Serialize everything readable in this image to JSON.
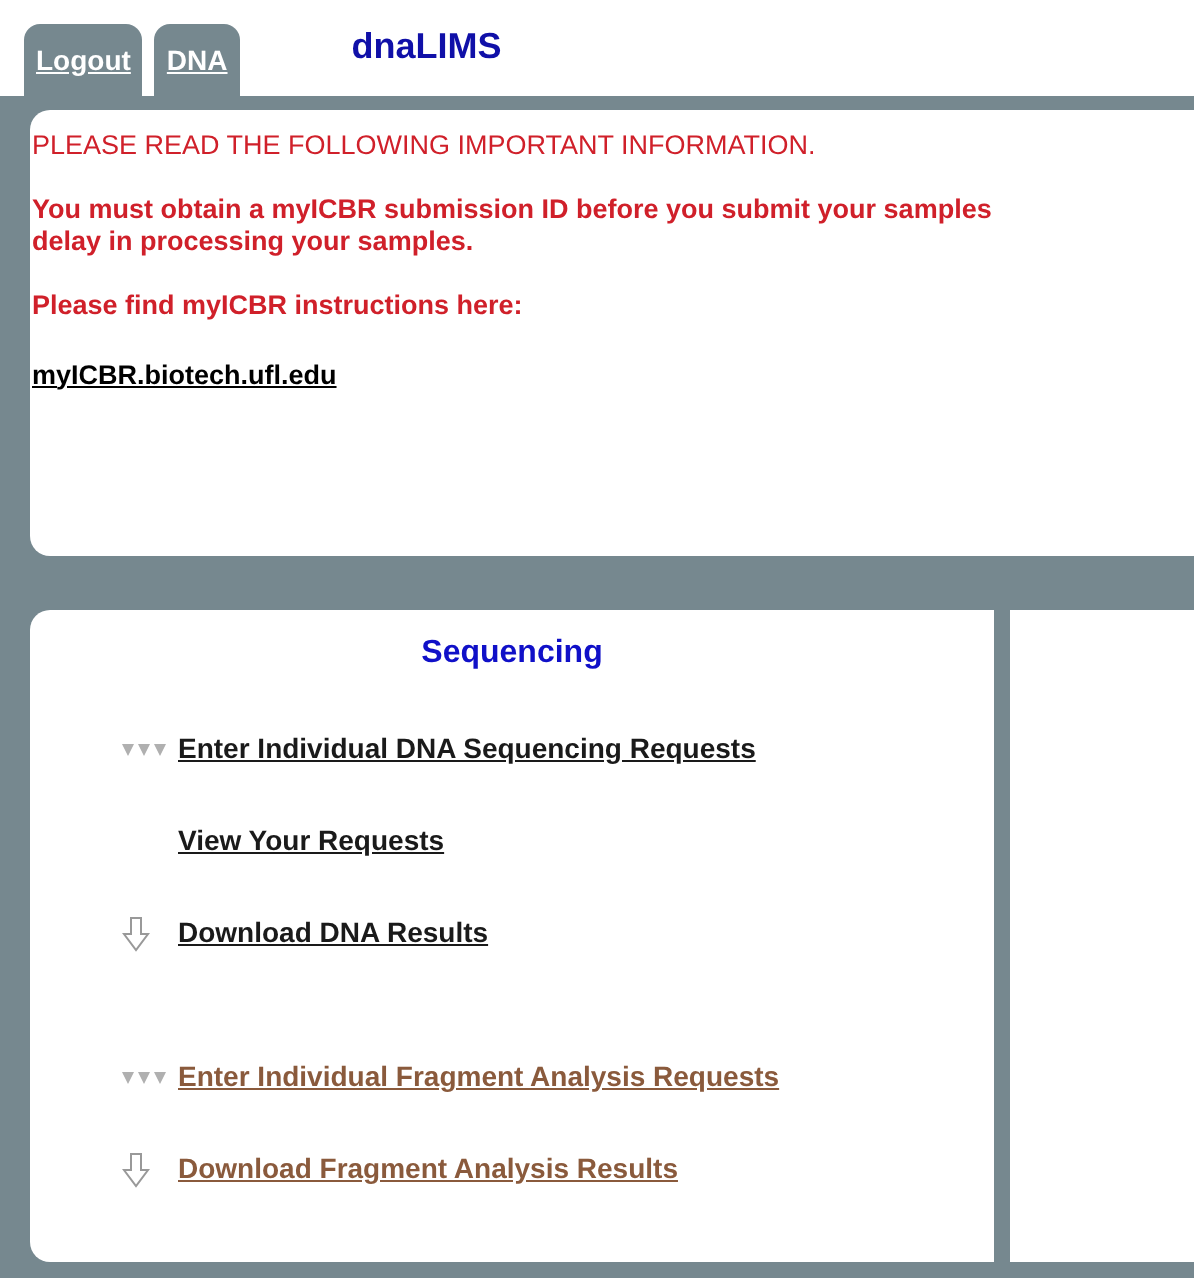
{
  "tabs": [
    {
      "label": "Logout"
    },
    {
      "label": "DNA"
    }
  ],
  "app_title": "dnaLIMS",
  "notice": {
    "heading": "PLEASE READ THE FOLLOWING IMPORTANT INFORMATION.",
    "paragraphs": [
      "You must obtain a myICBR submission ID before you submit your samples",
      "delay in processing your samples.",
      "Please find myICBR instructions here:"
    ],
    "link": "myICBR.biotech.ufl.edu"
  },
  "sequencing": {
    "title": "Sequencing",
    "links": [
      {
        "label": "Enter Individual DNA Sequencing Requests",
        "kind": "enter",
        "visited": false
      },
      {
        "label": "View Your Requests",
        "kind": "plain",
        "visited": false
      },
      {
        "label": "Download DNA Results",
        "kind": "download",
        "visited": false
      },
      {
        "label": "Enter Individual Fragment Analysis Requests",
        "kind": "enter",
        "visited": true
      },
      {
        "label": "Download Fragment Analysis Results",
        "kind": "download",
        "visited": true
      }
    ]
  }
}
